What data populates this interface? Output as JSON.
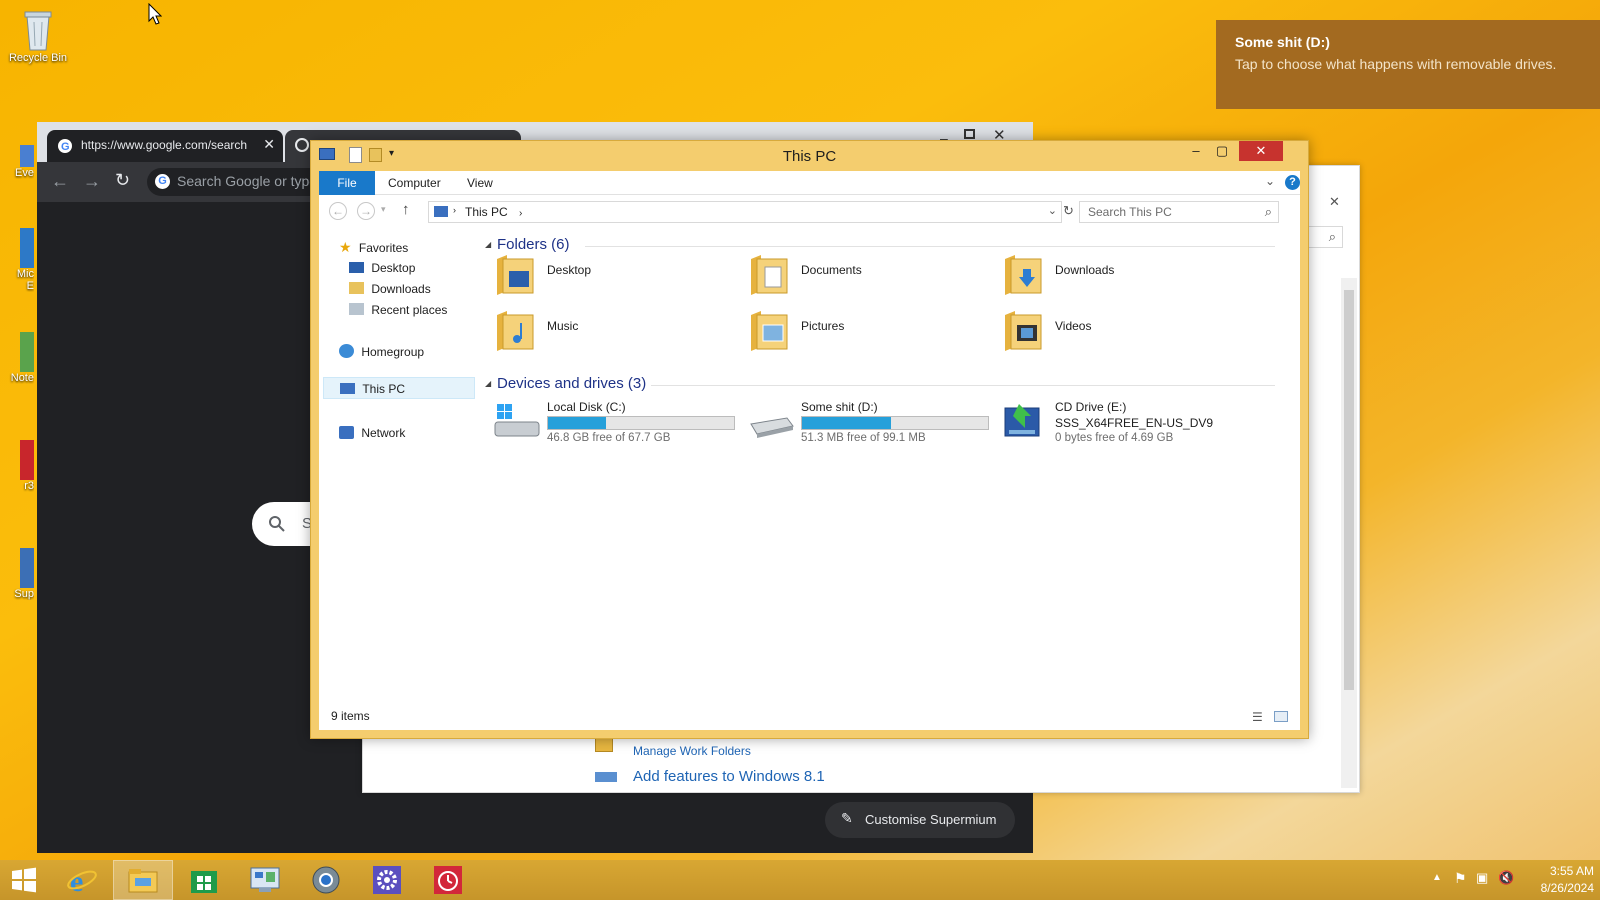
{
  "desktop": {
    "recycle_bin": "Recycle Bin",
    "partial_icons": [
      "Eve",
      "Mic",
      "E",
      "Note",
      "r3",
      "Sup"
    ]
  },
  "toast": {
    "title": "Some shit (D:)",
    "message": "Tap to choose what happens with removable drives."
  },
  "chrome": {
    "tab_url": "https://www.google.com/search",
    "omnibox_placeholder": "Search Google or type",
    "search_stub": "S",
    "customise_label": "Customise Supermium"
  },
  "control_panel": {
    "manage_work_folders": "Manage Work Folders",
    "add_features": "Add features to Windows 8.1"
  },
  "explorer": {
    "title": "This PC",
    "ribbon_tabs": [
      "File",
      "Computer",
      "View"
    ],
    "breadcrumb": "This PC",
    "search_placeholder": "Search This PC",
    "nav": {
      "favorites": "Favorites",
      "desktop": "Desktop",
      "downloads": "Downloads",
      "recent": "Recent places",
      "homegroup": "Homegroup",
      "thispc": "This PC",
      "network": "Network"
    },
    "folders_header": "Folders (6)",
    "folders": [
      "Desktop",
      "Documents",
      "Downloads",
      "Music",
      "Pictures",
      "Videos"
    ],
    "drives_header": "Devices and drives (3)",
    "drives": [
      {
        "name": "Local Disk (C:)",
        "free": "46.8 GB free of 67.7 GB",
        "used_fraction": 0.31
      },
      {
        "name": "Some shit (D:)",
        "free": "51.3 MB free of 99.1 MB",
        "used_fraction": 0.48
      },
      {
        "name": "CD Drive (E:)",
        "label": "SSS_X64FREE_EN-US_DV9",
        "free": "0 bytes free of 4.69 GB"
      }
    ],
    "status": "9 items"
  },
  "taskbar": {
    "time": "3:55 AM",
    "date": "8/26/2024"
  },
  "colors": {
    "accent": "#1979ca",
    "drive_bar": "#26a0da",
    "toast_bg": "#a36a20",
    "explorer_frame": "#f4cd6e"
  }
}
